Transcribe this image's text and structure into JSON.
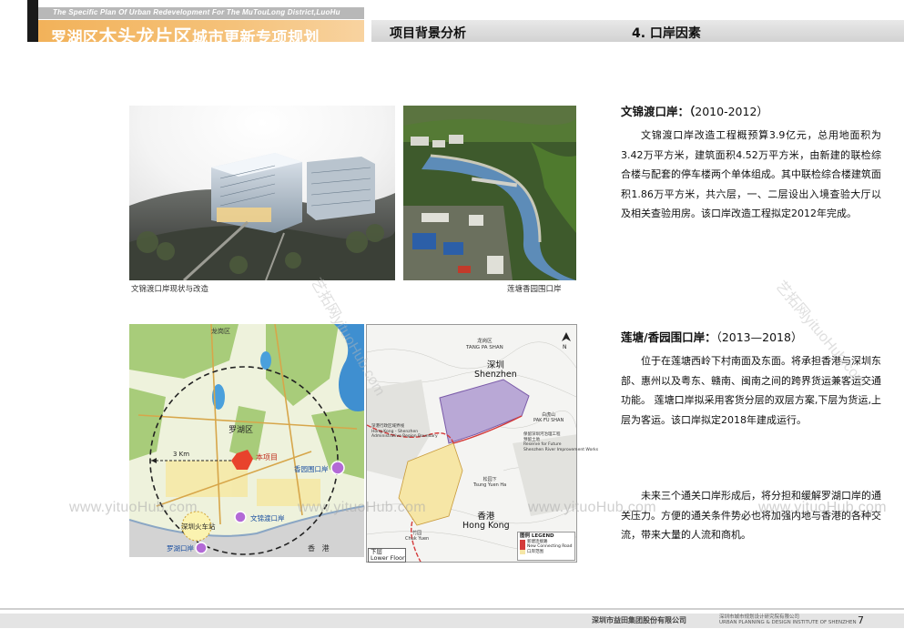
{
  "header": {
    "title_en": "The Specific Plan Of Urban Redevelopment For The MuTouLong District,LuoHu",
    "title_cn_pre": "罗湖区",
    "title_cn_big": "木头龙片区",
    "title_cn_post": "城市更新专项规划",
    "section": "项目背景分析",
    "subsection": "4. 口岸因素"
  },
  "images": {
    "wenjindu_caption": "文锦渡口岸现状与改造",
    "liantang_caption": "莲塘香园围口岸"
  },
  "map1": {
    "district": "罗湖区",
    "district_top": "龙岗区",
    "project": "本项目",
    "distance": "3 Km",
    "station": "深圳火车站",
    "port_liantang": "香园围口岸",
    "port_wenjin": "文锦渡口岸",
    "port_luohu": "罗湖口岸",
    "hongkong": "香   港"
  },
  "map2": {
    "longgang_cn": "龙岗区",
    "longgang_en": "TANG PA SHAN",
    "shenzhen_cn": "深圳",
    "shenzhen_en": "Shenzhen",
    "hongkong_cn": "香港",
    "hongkong_en": "Hong Kong",
    "boundary_label": "深港行政区域界线\nHong Kong - Shenzhen\nAdministrative Region Boundary",
    "river_label": "保留深圳河治理工程\n预留土地\nReserve for Future\nShenzhen River Improvement Works",
    "tong_yuen_cn": "打鼓岭",
    "tong_yuen_en": "Ta Kwu Ling",
    "pak_fu_cn": "白虎山",
    "pak_fu_en": "PAK FU SHAN",
    "tsung_cn": "松园下",
    "tsung_en": "Tsung Yuen Ha",
    "chuk_cn": "竹园",
    "chuk_en": "Chuk Yuen",
    "legend_title": "图例 LEGEND",
    "legend_1": "新建连接路\nNew Connecting Road",
    "legend_2": "口岸范围",
    "floor_cn": "下层",
    "floor_en": "Lower Floor"
  },
  "sections": [
    {
      "title": "文锦渡口岸：",
      "bracket": "（",
      "year": "2010-2012）",
      "body": "文锦渡口岸改造工程概预算3.9亿元，总用地面积为3.42万平方米，建筑面积4.52万平方米，由新建的联检综合楼与配套的停车楼两个单体组成。其中联检综合楼建筑面积1.86万平方米，共六层，一、二层设出入境查验大厅以及相关查验用房。该口岸改造工程拟定2012年完成。"
    },
    {
      "title": "莲塘/香园围口岸：",
      "year": "（2013—2018）",
      "body": "位于在莲塘西岭下村南面及东面。将承担香港与深圳东部、惠州以及粤东、赣南、闽南之间的跨界货运兼客运交通功能。 莲塘口岸拟采用客货分层的双层方案,下层为货运,上层为客运。该口岸拟定2018年建成运行。"
    }
  ],
  "conclusion": "未来三个通关口岸形成后，将分担和缓解罗湖口岸的通关压力。方便的通关条件势必也将加强内地与香港的各种交流，带来大量的人流和商机。",
  "watermarks": {
    "url": "www.yituoHub.com",
    "diag": "艺拓网yituoHub.com"
  },
  "footer": {
    "company1": "深圳市益田集团股份有限公司",
    "company2": "深圳市城市规划设计研究院有限公司\nURBAN PLANNING & DESIGN INSTITUTE OF SHENZHEN",
    "page": "7"
  }
}
